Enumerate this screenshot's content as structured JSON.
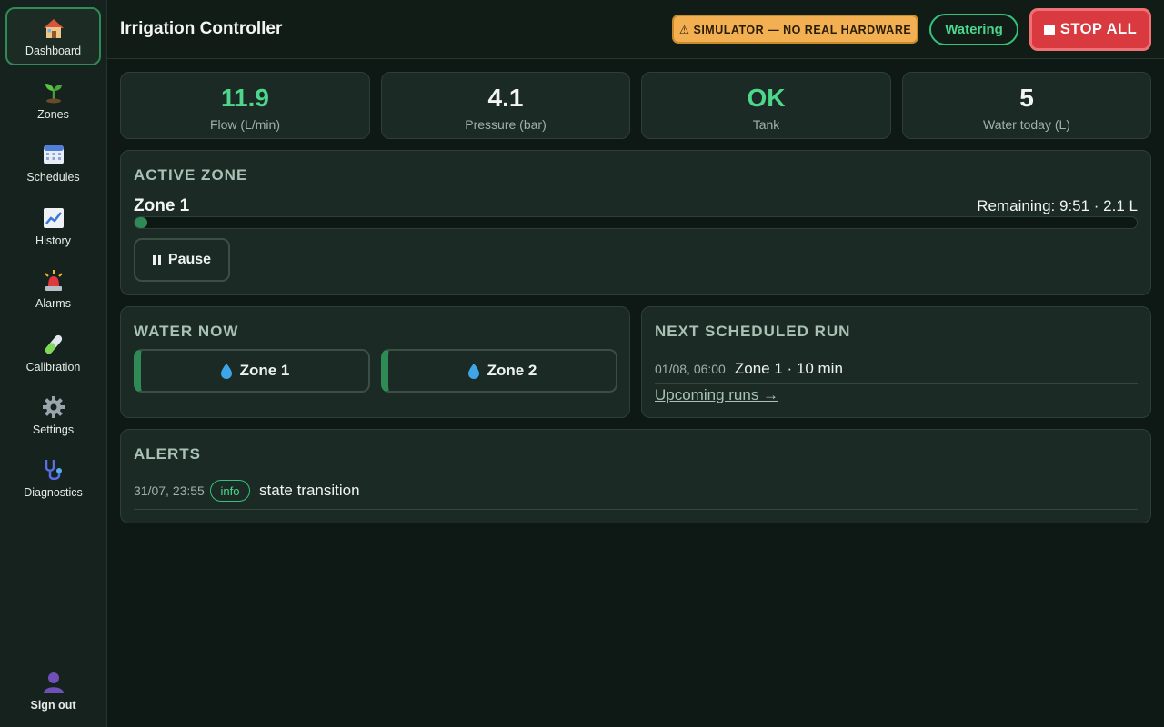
{
  "sidebar": {
    "items": [
      {
        "label": "Dashboard",
        "icon": "house-icon"
      },
      {
        "label": "Zones",
        "icon": "seedling-icon"
      },
      {
        "label": "Schedules",
        "icon": "calendar-icon"
      },
      {
        "label": "History",
        "icon": "chart-icon"
      },
      {
        "label": "Alarms",
        "icon": "siren-icon"
      },
      {
        "label": "Calibration",
        "icon": "test-tube-icon"
      },
      {
        "label": "Settings",
        "icon": "gear-icon"
      },
      {
        "label": "Diagnostics",
        "icon": "stethoscope-icon"
      }
    ],
    "sign_out": {
      "label": "Sign out",
      "icon": "user-icon"
    }
  },
  "header": {
    "title": "Irrigation Controller",
    "simulator_badge": "⚠ SIMULATOR — NO REAL HARDWARE",
    "status": "Watering",
    "stop_label": "STOP ALL"
  },
  "stats": [
    {
      "value": "11.9",
      "label": "Flow (L/min)",
      "color": "#4ed68c"
    },
    {
      "value": "4.1",
      "label": "Pressure (bar)",
      "color": "#f2f5f3"
    },
    {
      "value": "OK",
      "label": "Tank",
      "color": "#4ed68c"
    },
    {
      "value": "5",
      "label": "Water today (L)",
      "color": "#f2f5f3"
    }
  ],
  "active_zone": {
    "title": "ACTIVE ZONE",
    "zone": "Zone 1",
    "remaining": "Remaining: 9:51 · 2.1 L",
    "progress": 0.013,
    "pause_label": "Pause"
  },
  "water_now": {
    "title": "WATER NOW",
    "zones": [
      "Zone 1",
      "Zone 2"
    ]
  },
  "next_run": {
    "title": "NEXT SCHEDULED RUN",
    "date": "01/08, 06:00",
    "detail": "Zone 1 · 10 min",
    "link": "Upcoming runs →"
  },
  "alerts": {
    "title": "ALERTS",
    "items": [
      {
        "date": "31/07, 23:55",
        "level": "info",
        "message": "state transition"
      }
    ]
  },
  "colors": {
    "accent": "#2f8a55",
    "status_green": "#4ed68c",
    "stop_red": "#d93a3f",
    "warning": "#f2b052"
  }
}
